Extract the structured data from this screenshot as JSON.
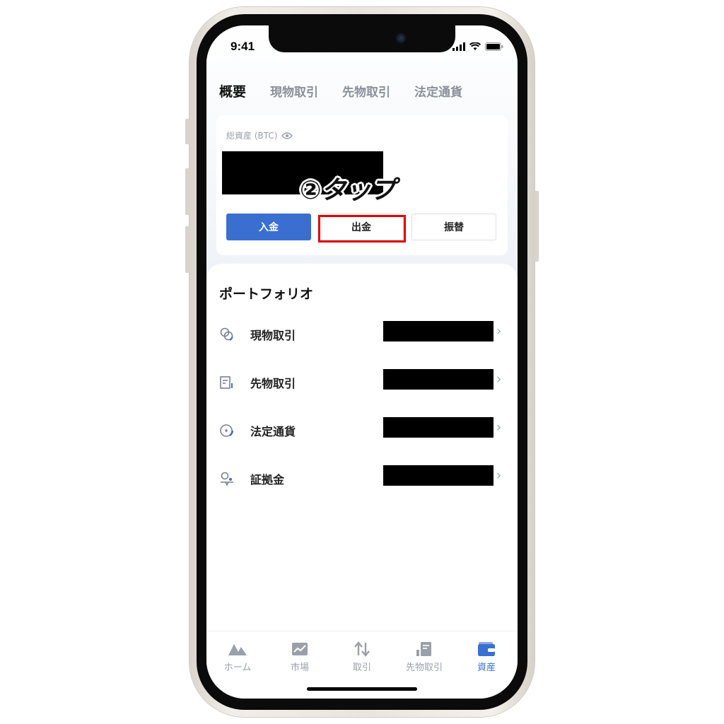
{
  "status_bar": {
    "time": "9:41",
    "icons": [
      "signal-icon",
      "wifi-icon",
      "battery-icon"
    ]
  },
  "tabs": [
    {
      "label": "概要",
      "active": true
    },
    {
      "label": "現物取引",
      "active": false
    },
    {
      "label": "先物取引",
      "active": false
    },
    {
      "label": "法定通貨",
      "active": false
    }
  ],
  "summary": {
    "total_label": "総資産 (BTC)",
    "visibility_icon": "eye-icon",
    "buttons": {
      "deposit": "入金",
      "withdraw": "出金",
      "transfer": "振替"
    }
  },
  "annotation": {
    "text": "②タップ",
    "highlight_color": "#e10000"
  },
  "portfolio": {
    "title": "ポートフォリオ",
    "items": [
      {
        "label": "現物取引",
        "icon": "spot-icon"
      },
      {
        "label": "先物取引",
        "icon": "futures-icon"
      },
      {
        "label": "法定通貨",
        "icon": "fiat-icon"
      },
      {
        "label": "証拠金",
        "icon": "margin-icon"
      }
    ]
  },
  "bottom_nav": [
    {
      "label": "ホーム",
      "icon": "home-icon",
      "active": false
    },
    {
      "label": "市場",
      "icon": "market-icon",
      "active": false
    },
    {
      "label": "取引",
      "icon": "trade-icon",
      "active": false
    },
    {
      "label": "先物取引",
      "icon": "futures-nav-icon",
      "active": false
    },
    {
      "label": "資産",
      "icon": "wallet-icon",
      "active": true
    }
  ],
  "colors": {
    "accent": "#3a6fd1",
    "highlight": "#e10000"
  }
}
